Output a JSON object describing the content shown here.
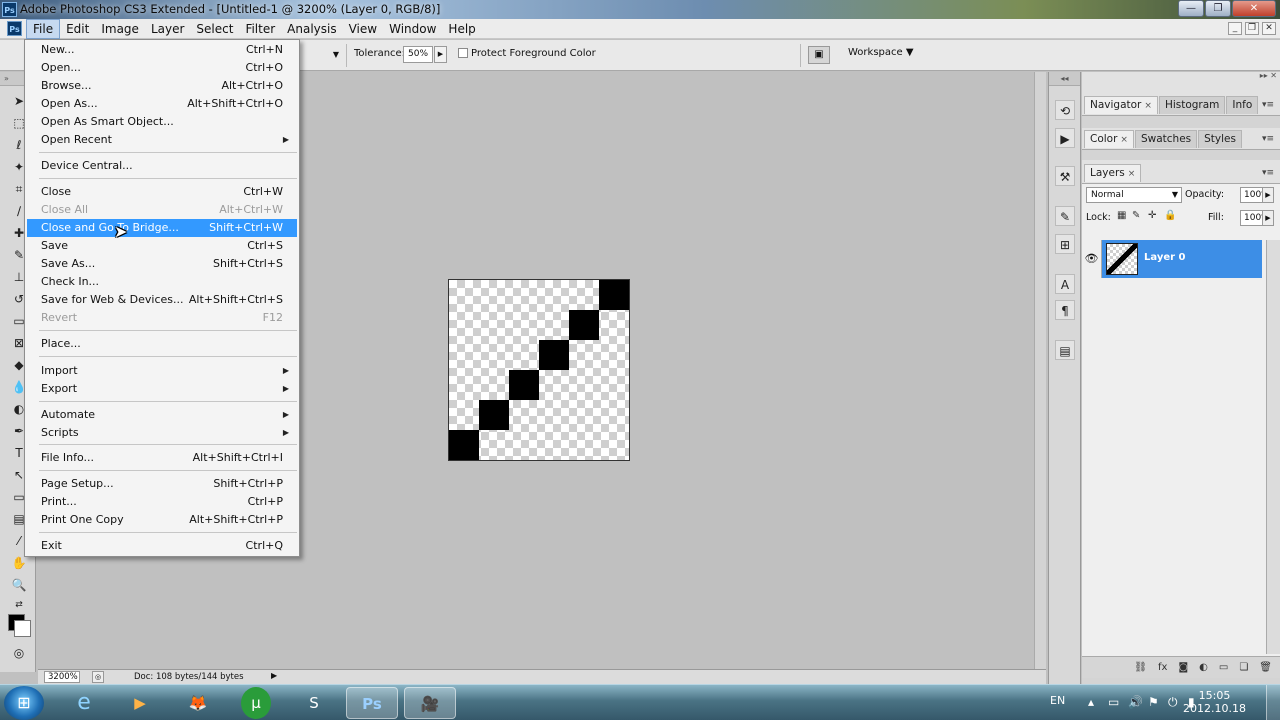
{
  "titlebar": {
    "app_icon": "Ps",
    "title": "Adobe Photoshop CS3 Extended - [Untitled-1 @ 3200% (Layer 0, RGB/8)]"
  },
  "menubar": {
    "app_icon": "Ps",
    "items": [
      "File",
      "Edit",
      "Image",
      "Layer",
      "Select",
      "Filter",
      "Analysis",
      "View",
      "Window",
      "Help"
    ],
    "active": "File"
  },
  "options": {
    "tolerance_label": "Tolerance:",
    "tolerance_value": "50%",
    "protect_label": "Protect Foreground Color",
    "workspace_label": "Workspace ▼"
  },
  "file_menu": {
    "items": [
      {
        "label": "New...",
        "shortcut": "Ctrl+N"
      },
      {
        "label": "Open...",
        "shortcut": "Ctrl+O"
      },
      {
        "label": "Browse...",
        "shortcut": "Alt+Ctrl+O"
      },
      {
        "label": "Open As...",
        "shortcut": "Alt+Shift+Ctrl+O"
      },
      {
        "label": "Open As Smart Object...",
        "shortcut": ""
      },
      {
        "label": "Open Recent",
        "shortcut": ""
      },
      {
        "label": "Device Central...",
        "shortcut": ""
      },
      {
        "label": "Close",
        "shortcut": "Ctrl+W"
      },
      {
        "label": "Close All",
        "shortcut": "Alt+Ctrl+W"
      },
      {
        "label": "Close and Go To Bridge...",
        "shortcut": "Shift+Ctrl+W"
      },
      {
        "label": "Save",
        "shortcut": "Ctrl+S"
      },
      {
        "label": "Save As...",
        "shortcut": "Shift+Ctrl+S"
      },
      {
        "label": "Check In...",
        "shortcut": ""
      },
      {
        "label": "Save for Web & Devices...",
        "shortcut": "Alt+Shift+Ctrl+S"
      },
      {
        "label": "Revert",
        "shortcut": "F12"
      },
      {
        "label": "Place...",
        "shortcut": ""
      },
      {
        "label": "Import",
        "shortcut": ""
      },
      {
        "label": "Export",
        "shortcut": ""
      },
      {
        "label": "Automate",
        "shortcut": ""
      },
      {
        "label": "Scripts",
        "shortcut": ""
      },
      {
        "label": "File Info...",
        "shortcut": "Alt+Shift+Ctrl+I"
      },
      {
        "label": "Page Setup...",
        "shortcut": "Shift+Ctrl+P"
      },
      {
        "label": "Print...",
        "shortcut": "Ctrl+P"
      },
      {
        "label": "Print One Copy",
        "shortcut": "Alt+Shift+Ctrl+P"
      },
      {
        "label": "Exit",
        "shortcut": "Ctrl+Q"
      }
    ]
  },
  "status": {
    "zoom": "3200%",
    "doc": "Doc: 108 bytes/144 bytes"
  },
  "panels": {
    "group1_tabs": [
      "Navigator",
      "Histogram",
      "Info"
    ],
    "group2_tabs": [
      "Color",
      "Swatches",
      "Styles"
    ],
    "layers_tab": "Layers",
    "blend_mode": "Normal",
    "opacity_label": "Opacity:",
    "opacity_value": "100%",
    "lock_label": "Lock:",
    "fill_label": "Fill:",
    "fill_value": "100%",
    "layer_name": "Layer 0"
  },
  "taskbar": {
    "lang": "EN",
    "time": "15:05",
    "date": "2012.10.18",
    "ps_label": "Ps"
  },
  "colors": {
    "menu_highlight": "#3399ff",
    "layer_selected": "#3d8ee6",
    "canvas_bg": "#c0c0c0"
  }
}
